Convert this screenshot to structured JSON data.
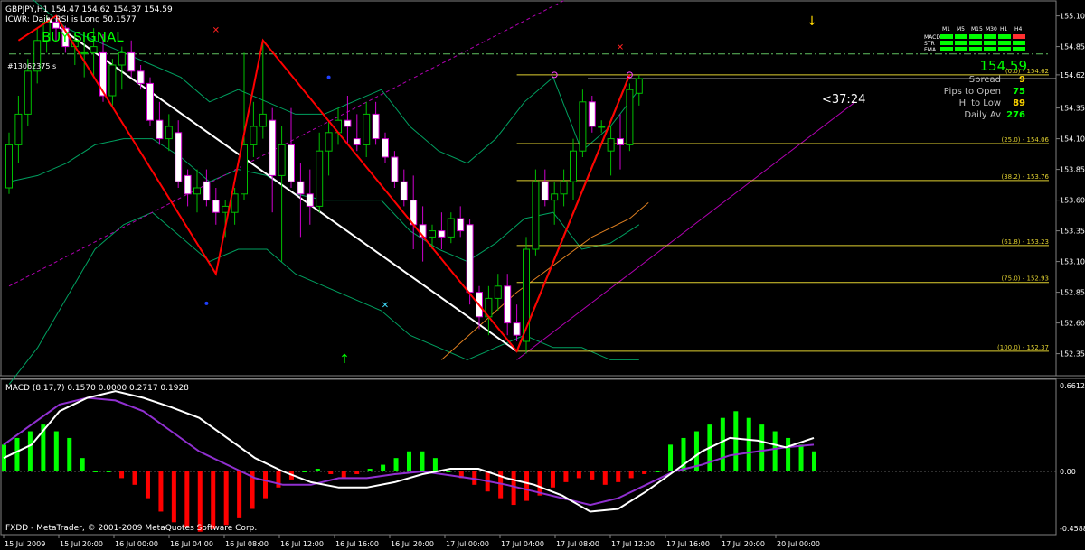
{
  "window": {
    "symbol_line": "GBPJPY,H1  154.47  154.62  154.37  154.59",
    "indicator_line": "ICWR: Daily RSI is Long 50.1577",
    "signal": "BUY SIGNAL",
    "ticket": "#13062375 s",
    "countdown": "<37:24",
    "footer": "FXDD - MetaTrader, © 2001-2009 MetaQuotes Software Corp."
  },
  "colors": {
    "background": "#000000",
    "grid": "#5a5a5a",
    "bull_candle": "#00c000",
    "bear_candle": "#ffffff",
    "zigzag": "#ff0000",
    "trendline": "#ffffff",
    "channel": "#b000b0",
    "bands": "#00a060",
    "fib": "#e0d030",
    "hist_up": "#00ff00",
    "hist_down": "#ff0000",
    "macd_line": "#ffffff",
    "signal_line": "#9030d0",
    "signal_text": "#00ff00"
  },
  "info_panel": {
    "timeframes": [
      "M1",
      "M5",
      "M15",
      "M30",
      "H1",
      "H4"
    ],
    "rows": [
      "MACD",
      "STR",
      "EMA"
    ],
    "grid_colors": [
      [
        "#00ff00",
        "#00ff00",
        "#00ff00",
        "#00ff00",
        "#00ff00",
        "#ff3030"
      ],
      [
        "#00ff00",
        "#00ff00",
        "#00ff00",
        "#00ff00",
        "#00ff00",
        "#00ff00"
      ],
      [
        "#00ff00",
        "#00ff00",
        "#00ff00",
        "#00ff00",
        "#00ff00",
        "#00ff00"
      ]
    ],
    "price": "154.59",
    "stats": [
      {
        "label": "Spread",
        "value": "9",
        "color": "#ffd700"
      },
      {
        "label": "Pips to Open",
        "value": "75",
        "color": "#00ff00"
      },
      {
        "label": "Hi to Low",
        "value": "89",
        "color": "#ffd700"
      },
      {
        "label": "Daily Av",
        "value": "276",
        "color": "#00ff00"
      }
    ]
  },
  "chart_data": [
    {
      "type": "candlestick",
      "title": "GBPJPY,H1",
      "ylim": [
        152.2,
        155.2
      ],
      "y_ticks": [
        "155.10",
        "154.85",
        "154.62",
        "154.35",
        "154.10",
        "153.85",
        "153.60",
        "153.35",
        "153.10",
        "152.85",
        "152.60",
        "152.35"
      ],
      "current_price_label": "154.59",
      "x_tick_labels": [
        "15 Jul 2009",
        "15 Jul 20:00",
        "16 Jul 00:00",
        "16 Jul 04:00",
        "16 Jul 08:00",
        "16 Jul 12:00",
        "16 Jul 16:00",
        "16 Jul 20:00",
        "17 Jul 00:00",
        "17 Jul 04:00",
        "17 Jul 08:00",
        "17 Jul 12:00",
        "17 Jul 16:00",
        "17 Jul 20:00",
        "20 Jul 00:00"
      ],
      "candles": [
        [
          153.7,
          154.15,
          153.65,
          154.05
        ],
        [
          154.05,
          154.45,
          153.9,
          154.3
        ],
        [
          154.3,
          154.75,
          154.2,
          154.65
        ],
        [
          154.65,
          155.0,
          154.55,
          154.9
        ],
        [
          154.9,
          155.1,
          154.8,
          155.05
        ],
        [
          155.05,
          155.08,
          154.9,
          155.0
        ],
        [
          155.0,
          155.02,
          154.8,
          154.85
        ],
        [
          154.85,
          154.95,
          154.7,
          154.9
        ],
        [
          154.8,
          154.88,
          154.6,
          154.8
        ],
        [
          154.8,
          155.0,
          154.6,
          154.85
        ],
        [
          154.8,
          154.95,
          154.4,
          154.45
        ],
        [
          154.45,
          154.75,
          154.35,
          154.7
        ],
        [
          154.7,
          154.85,
          154.5,
          154.8
        ],
        [
          154.8,
          154.9,
          154.6,
          154.65
        ],
        [
          154.65,
          154.7,
          154.5,
          154.55
        ],
        [
          154.55,
          154.6,
          154.2,
          154.25
        ],
        [
          154.25,
          154.4,
          154.05,
          154.1
        ],
        [
          154.1,
          154.3,
          154.0,
          154.2
        ],
        [
          154.15,
          154.25,
          153.7,
          153.75
        ],
        [
          153.8,
          153.85,
          153.55,
          153.65
        ],
        [
          153.65,
          153.85,
          153.5,
          153.7
        ],
        [
          153.75,
          153.85,
          153.55,
          153.6
        ],
        [
          153.6,
          153.7,
          153.4,
          153.5
        ],
        [
          153.5,
          153.6,
          153.3,
          153.55
        ],
        [
          153.5,
          153.7,
          153.4,
          153.65
        ],
        [
          153.65,
          154.8,
          153.6,
          154.05
        ],
        [
          154.05,
          154.4,
          153.95,
          154.2
        ],
        [
          154.2,
          154.9,
          154.1,
          154.3
        ],
        [
          154.25,
          154.35,
          153.5,
          153.8
        ],
        [
          153.8,
          154.2,
          153.1,
          154.05
        ],
        [
          154.05,
          154.35,
          153.7,
          153.75
        ],
        [
          153.75,
          153.9,
          153.3,
          153.65
        ],
        [
          153.65,
          153.85,
          153.4,
          153.55
        ],
        [
          153.55,
          154.15,
          153.5,
          154.0
        ],
        [
          154.0,
          154.25,
          153.8,
          154.15
        ],
        [
          154.15,
          154.35,
          154.05,
          154.25
        ],
        [
          154.25,
          154.45,
          154.05,
          154.2
        ],
        [
          154.1,
          154.3,
          154.0,
          154.05
        ],
        [
          154.05,
          154.4,
          153.95,
          154.3
        ],
        [
          154.3,
          154.4,
          154.05,
          154.1
        ],
        [
          154.1,
          154.15,
          153.9,
          153.95
        ],
        [
          153.95,
          154.0,
          153.7,
          153.75
        ],
        [
          153.75,
          153.85,
          153.55,
          153.6
        ],
        [
          153.6,
          153.8,
          153.2,
          153.4
        ],
        [
          153.4,
          153.55,
          153.1,
          153.3
        ],
        [
          153.3,
          153.4,
          153.2,
          153.35
        ],
        [
          153.35,
          153.5,
          153.2,
          153.3
        ],
        [
          153.3,
          153.5,
          153.25,
          153.45
        ],
        [
          153.45,
          153.55,
          153.3,
          153.35
        ],
        [
          153.4,
          153.45,
          152.75,
          152.85
        ],
        [
          152.85,
          152.9,
          152.55,
          152.65
        ],
        [
          152.65,
          152.9,
          152.5,
          152.8
        ],
        [
          152.8,
          153.0,
          152.7,
          152.9
        ],
        [
          152.9,
          153.0,
          152.5,
          152.6
        ],
        [
          152.6,
          152.75,
          152.45,
          152.5
        ],
        [
          152.45,
          153.3,
          152.35,
          153.2
        ],
        [
          153.2,
          153.85,
          153.15,
          153.75
        ],
        [
          153.75,
          153.85,
          153.55,
          153.6
        ],
        [
          153.6,
          153.75,
          153.4,
          153.65
        ],
        [
          153.65,
          153.85,
          153.55,
          153.75
        ],
        [
          153.75,
          154.1,
          153.6,
          154.0
        ],
        [
          154.0,
          154.5,
          153.95,
          154.4
        ],
        [
          154.4,
          154.45,
          154.15,
          154.2
        ],
        [
          154.2,
          154.25,
          154.15,
          154.2
        ],
        [
          154.0,
          154.2,
          153.8,
          154.1
        ],
        [
          154.1,
          154.3,
          153.85,
          154.05
        ],
        [
          154.05,
          154.55,
          154.0,
          154.5
        ],
        [
          154.47,
          154.62,
          154.37,
          154.59
        ]
      ],
      "fib_levels": [
        {
          "label": "(0.0) - 154.62",
          "value": 154.62
        },
        {
          "label": "(25.0) - 154.06",
          "value": 154.06
        },
        {
          "label": "(38.2) - 153.76",
          "value": 153.76
        },
        {
          "label": "(61.8) - 153.23",
          "value": 153.23
        },
        {
          "label": "(75.0) - 152.93",
          "value": 152.93
        },
        {
          "label": "(100.0) - 152.37",
          "value": 152.37
        }
      ],
      "hline_dashdot": 154.79,
      "zigzag": [
        [
          1,
          154.9
        ],
        [
          5,
          155.1
        ],
        [
          22,
          153.0
        ],
        [
          27,
          154.9
        ],
        [
          54,
          152.37
        ],
        [
          66,
          154.62
        ]
      ],
      "trendlines": [
        {
          "from": [
            4,
            155.08
          ],
          "to": [
            54,
            152.37
          ],
          "color": "#ffffff"
        },
        {
          "from": [
            54,
            152.37
          ],
          "to": [
            66,
            154.62
          ],
          "color": "#8a7a20"
        }
      ],
      "channel_lines": [
        {
          "from": [
            0,
            152.9
          ],
          "to": [
            66,
            155.5
          ],
          "dashed": true
        },
        {
          "from": [
            54,
            152.3
          ],
          "to": [
            90,
            154.4
          ],
          "dashed": false
        }
      ],
      "band_upper": [
        155.4,
        155.2,
        155.0,
        154.9,
        154.8,
        154.7,
        154.6,
        154.4,
        154.5,
        154.4,
        154.3,
        154.3,
        154.4,
        154.5,
        154.2,
        154.0,
        153.9,
        154.1,
        154.4,
        154.6,
        154.0,
        154.2,
        154.5
      ],
      "band_lower": [
        152.1,
        152.4,
        152.8,
        153.2,
        153.4,
        153.5,
        153.3,
        153.1,
        153.2,
        153.2,
        153.0,
        152.9,
        152.8,
        152.7,
        152.5,
        152.4,
        152.3,
        152.4,
        152.5,
        152.4,
        152.4,
        152.3,
        152.3
      ],
      "markers": [
        {
          "x": 6,
          "y": 155.05,
          "symbol": "down-arrow-yellow"
        },
        {
          "x": 65,
          "y": 154.85,
          "symbol": "x-red"
        },
        {
          "x": 22,
          "y": 154.99,
          "symbol": "x-red"
        },
        {
          "x": 40,
          "y": 152.75,
          "symbol": "x-cyan"
        },
        {
          "x": 41,
          "y": 152.5,
          "symbol": "up-arrow-green"
        },
        {
          "x": 21,
          "y": 152.76,
          "symbol": "dot-blue"
        },
        {
          "x": 34,
          "y": 154.6,
          "symbol": "dot-blue"
        },
        {
          "x": 58,
          "y": 154.62,
          "symbol": "dot-magenta"
        },
        {
          "x": 66,
          "y": 154.62,
          "symbol": "dot-magenta"
        }
      ]
    },
    {
      "type": "bar",
      "title": "MACD (8,17,7) 0.1570 0.0000 0.2717 0.1928",
      "ylim": [
        -0.4588,
        0.6612
      ],
      "y_ticks": [
        "0.6612",
        "0.00",
        "-0.4588"
      ],
      "histogram": [
        0.2,
        0.25,
        0.3,
        0.35,
        0.3,
        0.25,
        0.1,
        0.0,
        0.0,
        -0.05,
        -0.1,
        -0.2,
        -0.3,
        -0.38,
        -0.42,
        -0.45,
        -0.43,
        -0.4,
        -0.35,
        -0.28,
        -0.2,
        -0.12,
        -0.06,
        0.0,
        0.02,
        -0.02,
        -0.05,
        -0.02,
        0.02,
        0.05,
        0.1,
        0.15,
        0.15,
        0.1,
        0.0,
        -0.05,
        -0.1,
        -0.15,
        -0.2,
        -0.25,
        -0.22,
        -0.18,
        -0.12,
        -0.08,
        -0.05,
        -0.06,
        -0.1,
        -0.08,
        -0.05,
        -0.02,
        0.0,
        0.2,
        0.25,
        0.3,
        0.35,
        0.4,
        0.45,
        0.4,
        0.35,
        0.3,
        0.25,
        0.2,
        0.15
      ],
      "macd_line": [
        0.1,
        0.2,
        0.45,
        0.55,
        0.6,
        0.55,
        0.48,
        0.4,
        0.25,
        0.1,
        0.0,
        -0.08,
        -0.12,
        -0.12,
        -0.08,
        -0.02,
        0.02,
        0.02,
        -0.05,
        -0.1,
        -0.18,
        -0.3,
        -0.28,
        -0.15,
        0.0,
        0.15,
        0.25,
        0.23,
        0.18,
        0.25
      ],
      "signal_line": [
        0.2,
        0.35,
        0.5,
        0.55,
        0.53,
        0.45,
        0.3,
        0.15,
        0.05,
        -0.05,
        -0.1,
        -0.1,
        -0.05,
        -0.05,
        -0.02,
        0.0,
        -0.03,
        -0.06,
        -0.1,
        -0.15,
        -0.2,
        -0.25,
        -0.2,
        -0.1,
        0.0,
        0.05,
        0.12,
        0.15,
        0.18,
        0.2
      ]
    }
  ]
}
